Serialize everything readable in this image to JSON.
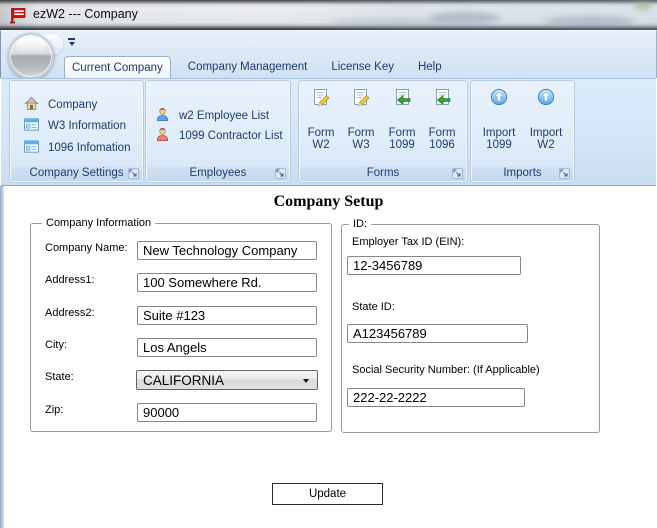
{
  "window": {
    "title": "ezW2 --- Company"
  },
  "tabs": [
    {
      "label": "Current Company",
      "active": true
    },
    {
      "label": "Company Management",
      "active": false
    },
    {
      "label": "License Key",
      "active": false
    },
    {
      "label": "Help",
      "active": false
    }
  ],
  "ribbon": {
    "groups": [
      {
        "caption": "Company Settings",
        "items": [
          {
            "label": "Company",
            "icon": "home-icon"
          },
          {
            "label": "W3 Information",
            "icon": "form-table-icon"
          },
          {
            "label": "1096 Infomation",
            "icon": "form-table-icon"
          }
        ]
      },
      {
        "caption": "Employees",
        "items": [
          {
            "label": "w2 Employee List",
            "icon": "person-blue-icon"
          },
          {
            "label": "1099 Contractor List",
            "icon": "person-red-icon"
          }
        ]
      },
      {
        "caption": "Forms",
        "items": [
          {
            "line1": "Form",
            "line2": "W2",
            "icon": "document-edit-icon"
          },
          {
            "line1": "Form",
            "line2": "W3",
            "icon": "document-edit-icon"
          },
          {
            "line1": "Form",
            "line2": "1099",
            "icon": "document-arrow-icon"
          },
          {
            "line1": "Form",
            "line2": "1096",
            "icon": "document-arrow-icon"
          }
        ]
      },
      {
        "caption": "Imports",
        "items": [
          {
            "line1": "Import",
            "line2": "1099",
            "icon": "import-up-icon"
          },
          {
            "line1": "Import",
            "line2": "W2",
            "icon": "import-up-icon"
          }
        ]
      }
    ]
  },
  "content": {
    "title": "Company Setup",
    "company_information": {
      "caption": "Company Information",
      "fields": [
        {
          "label": "Company Name:",
          "value": "New Technology Company"
        },
        {
          "label": "Address1:",
          "value": "100 Somewhere Rd."
        },
        {
          "label": "Address2:",
          "value": "Suite #123"
        },
        {
          "label": "City:",
          "value": "Los Angels"
        },
        {
          "label": "State:",
          "value": "CALIFORNIA"
        },
        {
          "label": "Zip:",
          "value": "90000"
        }
      ]
    },
    "id_section": {
      "caption": "ID:",
      "fields": [
        {
          "label": "Employer Tax ID (EIN):",
          "value": "12-3456789"
        },
        {
          "label": "State ID:",
          "value": "A123456789"
        },
        {
          "label": "Social Security Number: (If Applicable)",
          "value": "222-22-2222"
        }
      ]
    },
    "update_label": "Update"
  }
}
